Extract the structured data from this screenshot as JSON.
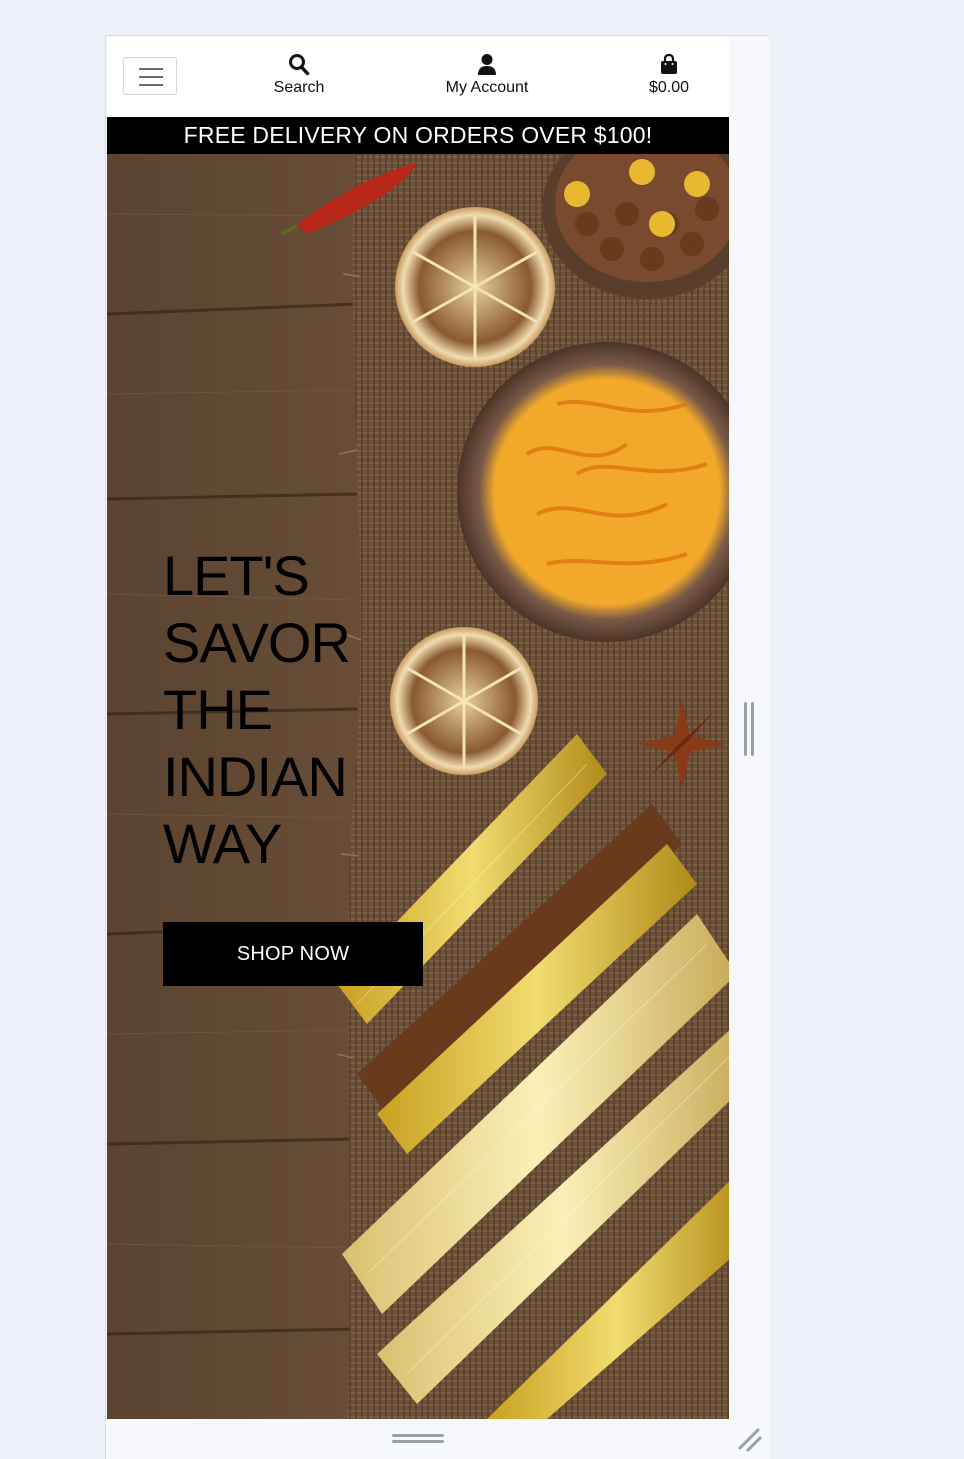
{
  "navbar": {
    "menu_icon": "hamburger-menu-icon",
    "search": {
      "label": "Search",
      "icon": "search-icon"
    },
    "account": {
      "label": "My Account",
      "icon": "user-icon"
    },
    "cart": {
      "label": "$0.00",
      "icon": "shopping-bag-icon"
    }
  },
  "banner": {
    "text": "FREE DELIVERY ON ORDERS OVER $100!"
  },
  "hero": {
    "heading_lines": [
      "LET'S",
      "SAVOR",
      "THE",
      "INDIAN",
      "WAY"
    ],
    "button_label": "SHOP NOW"
  },
  "colors": {
    "banner_bg": "#000000",
    "button_bg": "#000000",
    "page_bg": "#eef1f8"
  }
}
